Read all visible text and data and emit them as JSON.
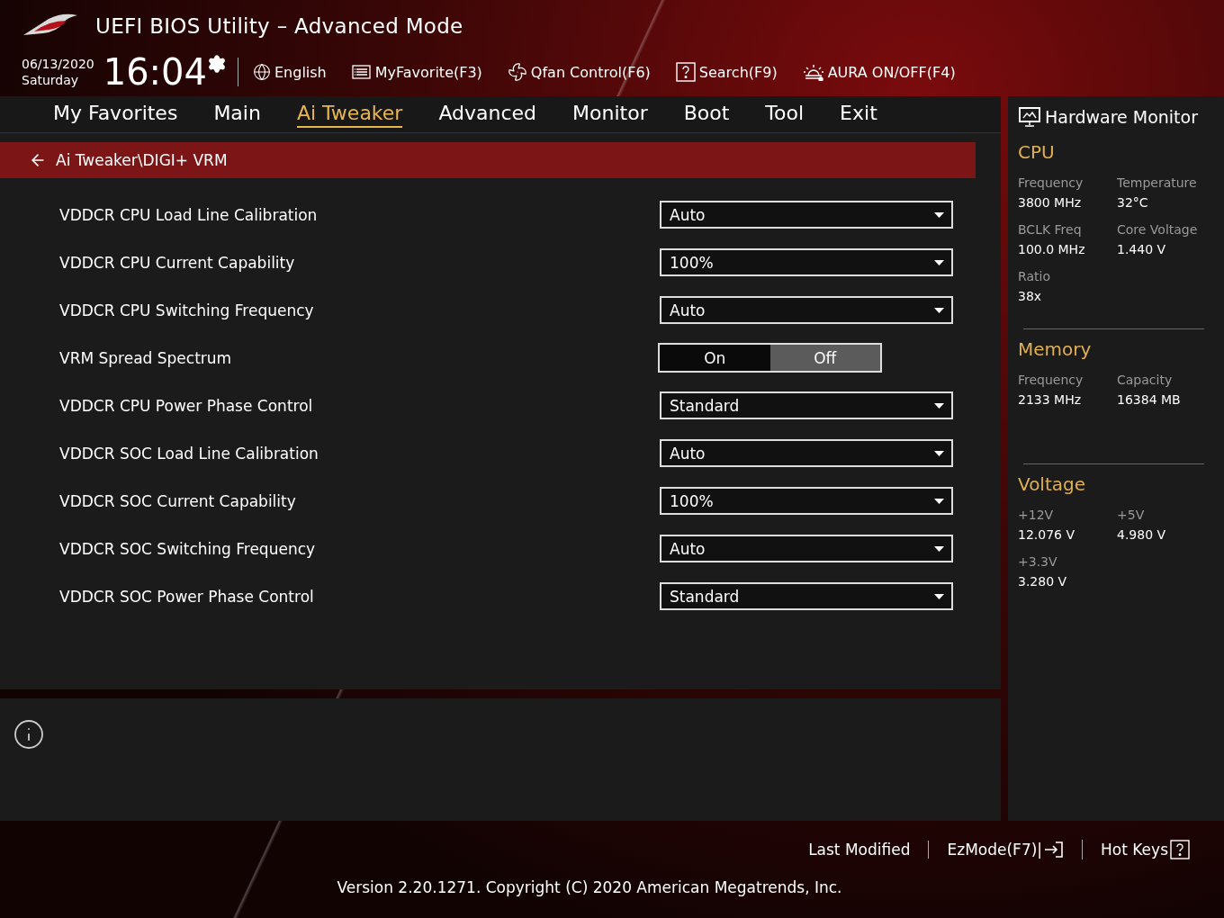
{
  "header": {
    "title": "UEFI BIOS Utility – Advanced Mode",
    "date": "06/13/2020",
    "day": "Saturday",
    "time": "16:04",
    "toolbar": [
      {
        "kind": "language",
        "label": "English"
      },
      {
        "kind": "favorite",
        "label": "MyFavorite(F3)"
      },
      {
        "kind": "fan",
        "label": "Qfan Control(F6)"
      },
      {
        "kind": "search",
        "label": "Search(F9)"
      },
      {
        "kind": "aura",
        "label": "AURA ON/OFF(F4)"
      }
    ]
  },
  "tabs": [
    {
      "label": "My Favorites",
      "selected": false
    },
    {
      "label": "Main",
      "selected": false
    },
    {
      "label": "Ai Tweaker",
      "selected": true
    },
    {
      "label": "Advanced",
      "selected": false
    },
    {
      "label": "Monitor",
      "selected": false
    },
    {
      "label": "Boot",
      "selected": false
    },
    {
      "label": "Tool",
      "selected": false
    },
    {
      "label": "Exit",
      "selected": false
    }
  ],
  "breadcrumb": "Ai Tweaker\\DIGI+ VRM",
  "settings": [
    {
      "kind": "dropdown",
      "label": "VDDCR CPU Load Line Calibration",
      "value": "Auto"
    },
    {
      "kind": "dropdown",
      "label": "VDDCR CPU Current Capability",
      "value": "100%"
    },
    {
      "kind": "dropdown",
      "label": "VDDCR CPU Switching Frequency",
      "value": "Auto"
    },
    {
      "kind": "toggle",
      "label": "VRM Spread Spectrum",
      "options": [
        {
          "label": "On",
          "selected": false
        },
        {
          "label": "Off",
          "selected": true
        }
      ]
    },
    {
      "kind": "dropdown",
      "label": "VDDCR CPU Power Phase Control",
      "value": "Standard"
    },
    {
      "kind": "dropdown",
      "label": "VDDCR SOC Load Line Calibration",
      "value": "Auto"
    },
    {
      "kind": "dropdown",
      "label": "VDDCR SOC Current Capability",
      "value": "100%"
    },
    {
      "kind": "dropdown",
      "label": "VDDCR SOC Switching Frequency",
      "value": "Auto"
    },
    {
      "kind": "dropdown",
      "label": "VDDCR SOC Power Phase Control",
      "value": "Standard"
    }
  ],
  "hardware_monitor": {
    "title": "Hardware Monitor",
    "sections": [
      {
        "title": "CPU",
        "items": [
          {
            "label": "Frequency",
            "value": "3800 MHz"
          },
          {
            "label": "Temperature",
            "value": "32°C"
          },
          {
            "label": "BCLK Freq",
            "value": "100.0 MHz"
          },
          {
            "label": "Core Voltage",
            "value": "1.440 V"
          },
          {
            "label": "Ratio",
            "value": "38x"
          }
        ]
      },
      {
        "title": "Memory",
        "items": [
          {
            "label": "Frequency",
            "value": "2133 MHz"
          },
          {
            "label": "Capacity",
            "value": "16384 MB"
          }
        ]
      },
      {
        "title": "Voltage",
        "items": [
          {
            "label": "+12V",
            "value": "12.076 V"
          },
          {
            "label": "+5V",
            "value": "4.980 V"
          },
          {
            "label": "+3.3V",
            "value": "3.280 V"
          }
        ]
      }
    ]
  },
  "footer": {
    "links": [
      {
        "kind": "plain",
        "label": "Last Modified"
      },
      {
        "kind": "exit",
        "label": "EzMode(F7)|"
      },
      {
        "kind": "help",
        "label": "Hot Keys"
      }
    ],
    "copyright": "Version 2.20.1271. Copyright (C) 2020 American Megatrends, Inc."
  }
}
